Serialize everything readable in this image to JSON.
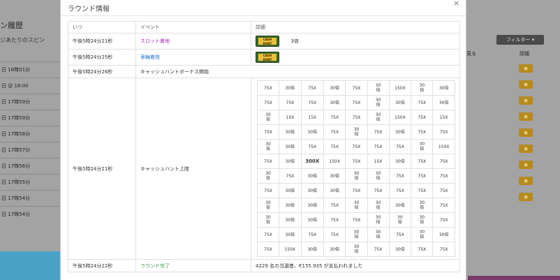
{
  "background": {
    "title": "ン履歴",
    "subtitle": "ジあたりのスピン",
    "filter_label": "フィルター ▾",
    "col_headers": [
      "見る",
      "詳細"
    ],
    "rows": [
      "日 18時01分",
      "日 @ 18:00",
      "日 17時59分",
      "日 17時59分",
      "日 17時58分",
      "日 17時57分",
      "日 17時56分",
      "日 17時55分",
      "日 17時54分",
      "日 17時54分"
    ]
  },
  "modal": {
    "title": "ラウンド情報",
    "close": "×",
    "headers": {
      "time": "いつ",
      "event": "イベント",
      "detail": "詳細"
    },
    "rows": [
      {
        "time": "午後5時24分21秒",
        "event": "スロット着地",
        "logo": "CASH HUNT",
        "detail": "3倍"
      },
      {
        "time": "午後5時24分25秒",
        "event": "車輪着陸",
        "logo": "CASH HUNT"
      },
      {
        "time": "午後5時24分26秒",
        "event": "キャッシュハントボーナス開始"
      },
      {
        "time": "午後5時24分21秒",
        "event": "キャッシュハント上陸"
      },
      {
        "time": "午後5時24分22秒",
        "event": "ラウンド完了",
        "detail": "4229 名の当選者、€155.935 が支払われました"
      }
    ],
    "grid": [
      [
        "75X",
        "30倍",
        "75X",
        "30倍",
        "75X",
        "30\n倍",
        "150X",
        "30\n倍",
        "30倍"
      ],
      [
        "75X",
        "75X",
        "75X",
        "30倍",
        "75X",
        "30\n倍",
        "30倍",
        "75X",
        "30倍"
      ],
      [
        "30\n倍",
        "15X",
        "15X",
        "75X",
        "75X",
        "30\n倍",
        "150X",
        "75X",
        "15X"
      ],
      [
        "75X",
        "30倍",
        "30倍",
        "75X",
        "30\n倍",
        "75X",
        "30倍",
        "75X",
        "75X"
      ],
      [
        "30\n倍",
        "30倍",
        "75X",
        "75X",
        "75X",
        "75X",
        "75X",
        "30\n倍",
        "150X"
      ],
      [
        "75X",
        "30倍",
        "300X",
        "150X",
        "75X",
        "15X",
        "30倍",
        "75X",
        "75X"
      ],
      [
        "30\n倍",
        "75X",
        "30倍",
        "30倍",
        "30\n倍",
        "30\n倍",
        "75X",
        "75X",
        "75X"
      ],
      [
        "75X",
        "30倍",
        "30倍",
        "30倍",
        "75X",
        "75X",
        "75X",
        "75X",
        "75X"
      ],
      [
        "30\n倍",
        "30倍",
        "30倍",
        "75X",
        "30\n倍",
        "30\n倍",
        "30倍",
        "30\n倍",
        "75X"
      ],
      [
        "30\n倍",
        "30倍",
        "30倍",
        "75X",
        "75X",
        "30\n倍",
        "30\n倍",
        "30\n倍",
        "75X"
      ],
      [
        "75X",
        "30倍",
        "75X",
        "75X",
        "30\n倍",
        "30\n倍",
        "75X",
        "30\n倍",
        "30倍"
      ],
      [
        "75X",
        "150X",
        "30倍",
        "30倍",
        "30\n倍",
        "75X",
        "30倍",
        "75X",
        "75X"
      ]
    ],
    "highlight": "300X"
  },
  "colors": {
    "slot_event": "#b02bb0",
    "wheel_event": "#2a7bd0",
    "done_event": "#3aa14a",
    "eye_button": "#b58a20"
  }
}
